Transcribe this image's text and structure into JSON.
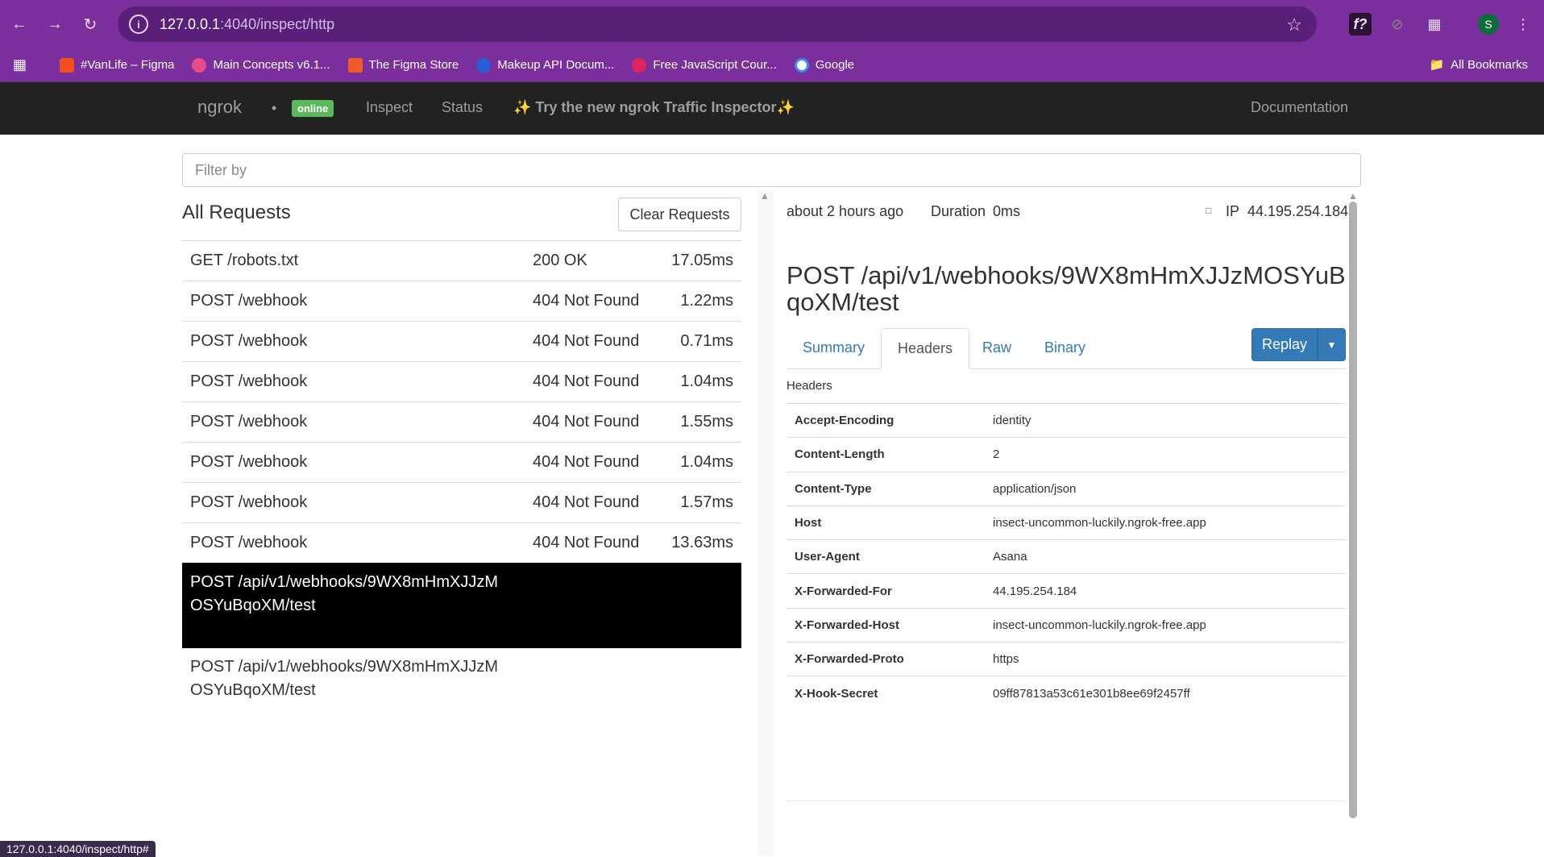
{
  "browser": {
    "url_host": "127.0.0.1",
    "url_path": ":4040/inspect/http",
    "bookmarks": [
      {
        "label": "#VanLife – Figma",
        "color": "#f24e1e"
      },
      {
        "label": "Main Concepts v6.1...",
        "color": "#e44d8a"
      },
      {
        "label": "The Figma Store",
        "color": "#f05a28"
      },
      {
        "label": "Makeup API Docum...",
        "color": "#2a5cd6"
      },
      {
        "label": "Free JavaScript Cour...",
        "color": "#e0245e"
      },
      {
        "label": "Google",
        "color": "#ffffff"
      }
    ],
    "all_bookmarks": "All Bookmarks",
    "avatar_letter": "S",
    "status_url": "127.0.0.1:4040/inspect/http#"
  },
  "navbar": {
    "brand": "ngrok",
    "dot": "•",
    "badge": "online",
    "links": [
      "Inspect",
      "Status",
      "✨ Try the new ngrok Traffic Inspector✨"
    ],
    "doc": "Documentation"
  },
  "filter": {
    "placeholder": "Filter by"
  },
  "requests": {
    "heading": "All Requests",
    "clear_label": "Clear Requests",
    "rows": [
      {
        "path": "GET /robots.txt",
        "status": "200 OK",
        "duration": "17.05ms"
      },
      {
        "path": "POST /webhook",
        "status": "404 Not Found",
        "duration": "1.22ms"
      },
      {
        "path": "POST /webhook",
        "status": "404 Not Found",
        "duration": "0.71ms"
      },
      {
        "path": "POST /webhook",
        "status": "404 Not Found",
        "duration": "1.04ms"
      },
      {
        "path": "POST /webhook",
        "status": "404 Not Found",
        "duration": "1.55ms"
      },
      {
        "path": "POST /webhook",
        "status": "404 Not Found",
        "duration": "1.04ms"
      },
      {
        "path": "POST /webhook",
        "status": "404 Not Found",
        "duration": "1.57ms"
      },
      {
        "path": "POST /webhook",
        "status": "404 Not Found",
        "duration": "13.63ms"
      },
      {
        "path": "POST /api/v1/webhooks/9WX8mHmXJJzMOSYuBqoXM/test",
        "status": "",
        "duration": ""
      },
      {
        "path": "POST /api/v1/webhooks/9WX8mHmXJJzMOSYuBqoXM/test",
        "status": "",
        "duration": ""
      }
    ]
  },
  "detail": {
    "time": "about 2 hours ago",
    "duration_label": "Duration",
    "duration_value": "0ms",
    "ip_label": "IP",
    "ip_value": "44.195.254.184",
    "title": "POST /api/v1/webhooks/9WX8mHmXJJzMOSYuBqoXM/test",
    "tabs": [
      "Summary",
      "Headers",
      "Raw",
      "Binary"
    ],
    "replay": "Replay",
    "headers_label": "Headers",
    "headers": [
      {
        "k": "Accept-Encoding",
        "v": "identity"
      },
      {
        "k": "Content-Length",
        "v": "2"
      },
      {
        "k": "Content-Type",
        "v": "application/json"
      },
      {
        "k": "Host",
        "v": "insect-uncommon-luckily.ngrok-free.app"
      },
      {
        "k": "User-Agent",
        "v": "Asana"
      },
      {
        "k": "X-Forwarded-For",
        "v": "44.195.254.184"
      },
      {
        "k": "X-Forwarded-Host",
        "v": "insect-uncommon-luckily.ngrok-free.app"
      },
      {
        "k": "X-Forwarded-Proto",
        "v": "https"
      },
      {
        "k": "X-Hook-Secret",
        "v": "09ff87813a53c61e301b8ee69f2457ff"
      }
    ]
  }
}
